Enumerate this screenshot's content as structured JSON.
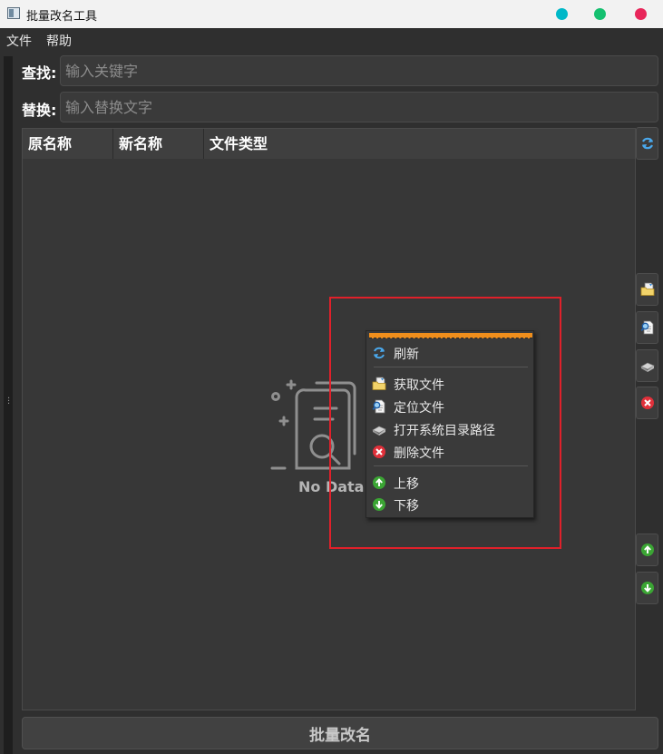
{
  "window": {
    "title": "批量改名工具",
    "controls": {
      "dot1_color": "#00b8c8",
      "dot2_color": "#15c070",
      "dot3_color": "#e8265a"
    }
  },
  "menubar": {
    "file": "文件",
    "help": "帮助"
  },
  "search": {
    "label": "查找:",
    "placeholder": "输入关键字",
    "value": ""
  },
  "replace": {
    "label": "替换:",
    "placeholder": "输入替换文字",
    "value": ""
  },
  "table": {
    "columns": [
      "原名称",
      "新名称",
      "文件类型"
    ],
    "rows": [],
    "empty_text": "No Data"
  },
  "side_buttons": [
    "refresh-icon",
    "open-folder-icon",
    "locate-file-icon",
    "open-dir-icon",
    "delete-icon",
    "move-up-icon",
    "move-down-icon"
  ],
  "context_menu": {
    "items": [
      {
        "label": "刷新",
        "icon": "refresh-icon"
      },
      {
        "label": "获取文件",
        "icon": "open-folder-icon"
      },
      {
        "label": "定位文件",
        "icon": "locate-file-icon"
      },
      {
        "label": "打开系统目录路径",
        "icon": "open-dir-icon"
      },
      {
        "label": "删除文件",
        "icon": "delete-icon"
      },
      {
        "label": "上移",
        "icon": "move-up-icon"
      },
      {
        "label": "下移",
        "icon": "move-down-icon"
      }
    ]
  },
  "footer": {
    "rename_button": "批量改名"
  },
  "colors": {
    "accent_tearoff": "#ef8e1c",
    "highlight": "#e0202a",
    "background": "#2f2f2f"
  }
}
